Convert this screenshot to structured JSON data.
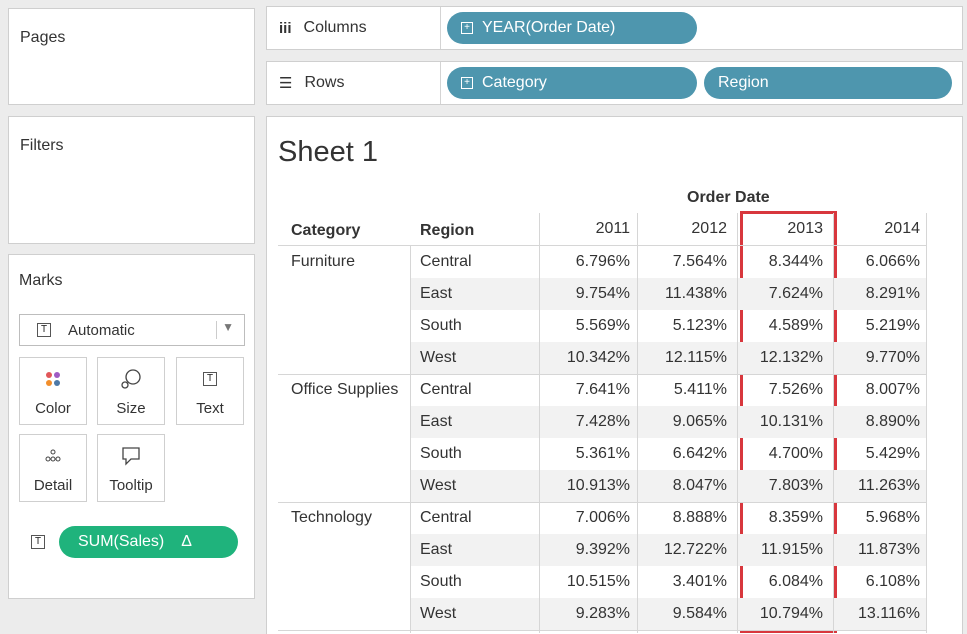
{
  "pages": {
    "title": "Pages"
  },
  "filters": {
    "title": "Filters"
  },
  "columns_shelf": {
    "label": "Columns",
    "pills": [
      "YEAR(Order Date)"
    ]
  },
  "rows_shelf": {
    "label": "Rows",
    "pills": [
      "Category",
      "Region"
    ]
  },
  "marks": {
    "title": "Marks",
    "mark_type": "Automatic",
    "buttons": {
      "color": "Color",
      "size": "Size",
      "text": "Text",
      "detail": "Detail",
      "tooltip": "Tooltip"
    },
    "text_pill": "SUM(Sales)",
    "text_pill_delta": "Δ"
  },
  "view": {
    "sheet_title": "Sheet 1",
    "column_group_header": "Order Date",
    "headers": {
      "category": "Category",
      "region": "Region"
    },
    "years": [
      "2011",
      "2012",
      "2013",
      "2014"
    ],
    "highlighted_year": "2013",
    "categories": [
      {
        "name": "Furniture",
        "rows": [
          {
            "region": "Central",
            "values": [
              "6.796%",
              "7.564%",
              "8.344%",
              "6.066%"
            ]
          },
          {
            "region": "East",
            "values": [
              "9.754%",
              "11.438%",
              "7.624%",
              "8.291%"
            ]
          },
          {
            "region": "South",
            "values": [
              "5.569%",
              "5.123%",
              "4.589%",
              "5.219%"
            ]
          },
          {
            "region": "West",
            "values": [
              "10.342%",
              "12.115%",
              "12.132%",
              "9.770%"
            ]
          }
        ]
      },
      {
        "name": "Office Supplies",
        "rows": [
          {
            "region": "Central",
            "values": [
              "7.641%",
              "5.411%",
              "7.526%",
              "8.007%"
            ]
          },
          {
            "region": "East",
            "values": [
              "7.428%",
              "9.065%",
              "10.131%",
              "8.890%"
            ]
          },
          {
            "region": "South",
            "values": [
              "5.361%",
              "6.642%",
              "4.700%",
              "5.429%"
            ]
          },
          {
            "region": "West",
            "values": [
              "10.913%",
              "8.047%",
              "7.803%",
              "11.263%"
            ]
          }
        ]
      },
      {
        "name": "Technology",
        "rows": [
          {
            "region": "Central",
            "values": [
              "7.006%",
              "8.888%",
              "8.359%",
              "5.968%"
            ]
          },
          {
            "region": "East",
            "values": [
              "9.392%",
              "12.722%",
              "11.915%",
              "11.873%"
            ]
          },
          {
            "region": "South",
            "values": [
              "10.515%",
              "3.401%",
              "6.084%",
              "6.108%"
            ]
          },
          {
            "region": "West",
            "values": [
              "9.283%",
              "9.584%",
              "10.794%",
              "13.116%"
            ]
          }
        ]
      }
    ]
  },
  "colors": {
    "dimension_pill": "#4e96ae",
    "measure_pill": "#1fb37c",
    "highlight": "#d8373d"
  }
}
